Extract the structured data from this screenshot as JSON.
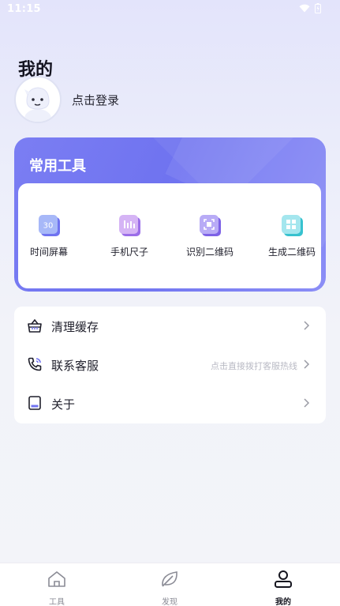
{
  "status_bar": {
    "time": "11:15"
  },
  "profile": {
    "title": "我的",
    "login_text": "点击登录"
  },
  "tools": {
    "title": "常用工具",
    "items": [
      {
        "label": "时间屏幕",
        "icon": "clock-screen-icon",
        "badge": "30"
      },
      {
        "label": "手机尺子",
        "icon": "ruler-icon"
      },
      {
        "label": "识别二维码",
        "icon": "qr-scan-icon"
      },
      {
        "label": "生成二维码",
        "icon": "qr-generate-icon"
      }
    ]
  },
  "menu": [
    {
      "label": "清理缓存",
      "icon": "basket-icon",
      "hint": ""
    },
    {
      "label": "联系客服",
      "icon": "phone-icon",
      "hint": "点击直接拨打客服热线"
    },
    {
      "label": "关于",
      "icon": "book-icon",
      "hint": ""
    }
  ],
  "tabbar": [
    {
      "label": "工具",
      "icon": "home-icon",
      "active": false
    },
    {
      "label": "发现",
      "icon": "leaf-icon",
      "active": false
    },
    {
      "label": "我的",
      "icon": "person-icon",
      "active": true
    }
  ],
  "colors": {
    "accent": "#7073f0",
    "card_gradient_start": "#7b7ef3",
    "card_gradient_end": "#8b8ef6",
    "tab_active": "#15151f",
    "tab_inactive": "#8a8b95"
  }
}
